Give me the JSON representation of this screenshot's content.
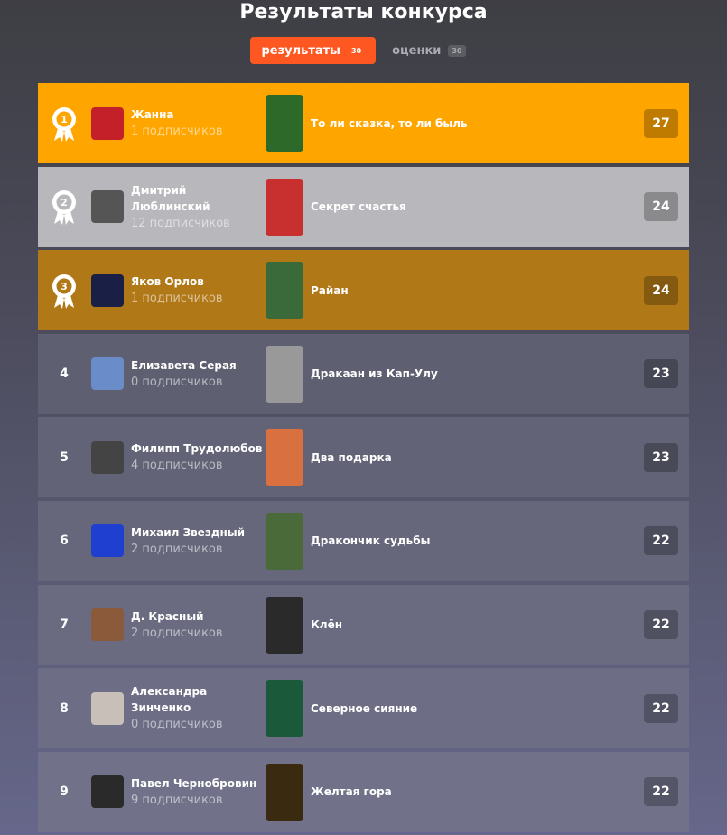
{
  "header": {
    "title": "Результаты конкурса"
  },
  "tabs": [
    {
      "label": "результаты",
      "count": "30",
      "active": true
    },
    {
      "label": "оценки",
      "count": "30",
      "active": false
    }
  ],
  "rows": [
    {
      "rank": "1",
      "author": "Жанна",
      "subs": "1 подписчиков",
      "story": "То ли сказка, то ли быль",
      "score": "27",
      "bg": "#ffa500"
    },
    {
      "rank": "2",
      "author": "Дмитрий Люблинский",
      "subs": "12 подписчиков",
      "story": "Секрет счастья",
      "score": "24",
      "bg": "#b8b8bc"
    },
    {
      "rank": "3",
      "author": "Яков Орлов",
      "subs": "1 подписчиков",
      "story": "Райан",
      "score": "24",
      "bg": "#b07817"
    },
    {
      "rank": "4",
      "author": "Елизавета Серая",
      "subs": "0 подписчиков",
      "story": "Дракаан из Кап-Улу",
      "score": "23",
      "bg": "#5e5f70"
    },
    {
      "rank": "5",
      "author": "Филипп Трудолюбов",
      "subs": "4 подписчиков",
      "story": "Два подарка",
      "score": "23",
      "bg": "#626376"
    },
    {
      "rank": "6",
      "author": "Михаил Звездный",
      "subs": "2 подписчиков",
      "story": "Дракончик судьбы",
      "score": "22",
      "bg": "#66677b"
    },
    {
      "rank": "7",
      "author": "Д. Красный",
      "subs": "2 подписчиков",
      "story": "Клён",
      "score": "22",
      "bg": "#6a6b80"
    },
    {
      "rank": "8",
      "author": "Александра Зинченко",
      "subs": "0 подписчиков",
      "story": "Северное сияние",
      "score": "22",
      "bg": "#6d6e85"
    },
    {
      "rank": "9",
      "author": "Павел Чернобровин",
      "subs": "9 подписчиков",
      "story": "Желтая гора",
      "score": "22",
      "bg": "#71728a"
    }
  ]
}
